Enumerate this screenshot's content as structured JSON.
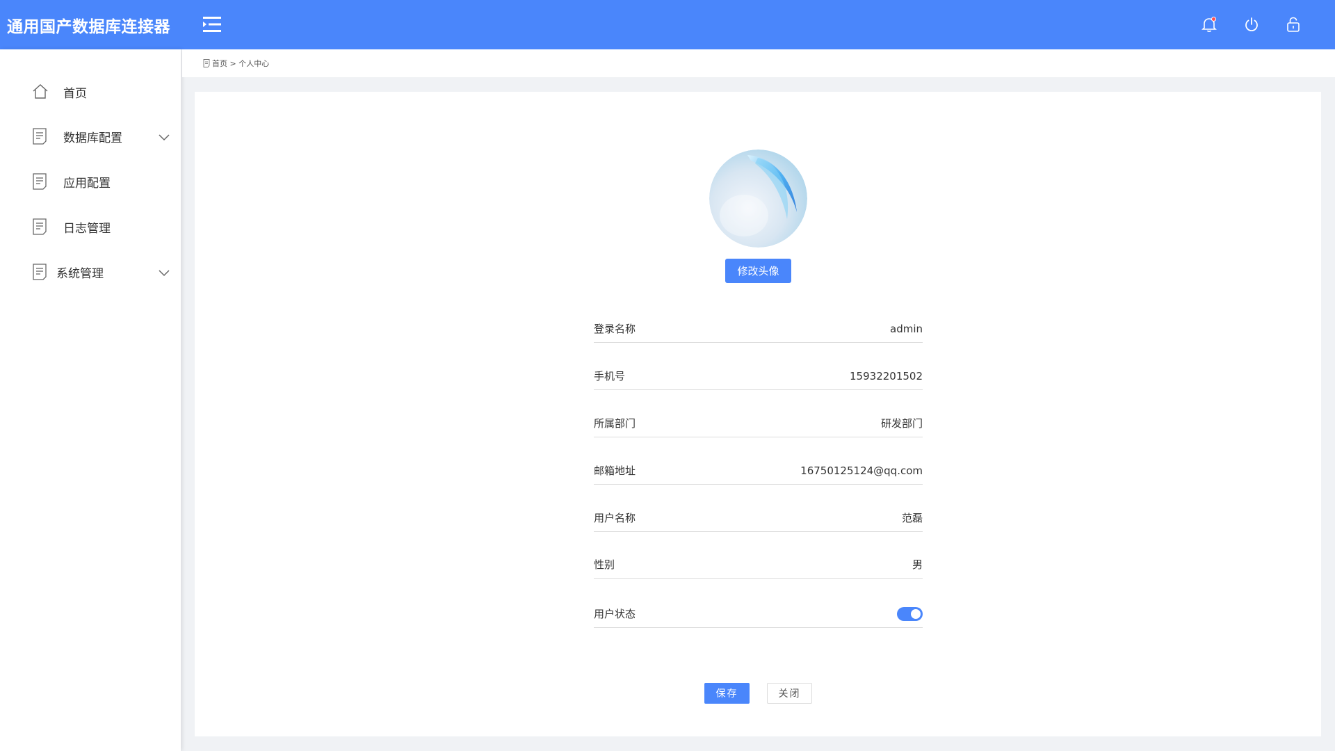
{
  "app": {
    "title": "通用国产数据库连接器"
  },
  "header": {
    "icons": [
      "menu-toggle-icon",
      "bell-icon",
      "power-icon",
      "lock-icon"
    ],
    "accent_color": "#4a86fb"
  },
  "sidebar": {
    "items": [
      {
        "label": "首页",
        "icon": "home-icon",
        "expandable": false
      },
      {
        "label": "数据库配置",
        "icon": "document-icon",
        "expandable": true
      },
      {
        "label": "应用配置",
        "icon": "document-icon",
        "expandable": false
      },
      {
        "label": "日志管理",
        "icon": "document-icon",
        "expandable": false
      },
      {
        "label": "系统管理",
        "icon": "document-icon",
        "expandable": true
      }
    ]
  },
  "breadcrumb": {
    "text": "首页 > 个人中心"
  },
  "profile": {
    "change_avatar_label": "修改头像",
    "fields": [
      {
        "label": "登录名称",
        "value": "admin"
      },
      {
        "label": "手机号",
        "value": "15932201502"
      },
      {
        "label": "所属部门",
        "value": "研发部门"
      },
      {
        "label": "邮箱地址",
        "value": "16750125124@qq.com"
      },
      {
        "label": "用户名称",
        "value": "范磊"
      },
      {
        "label": "性别",
        "value": "男"
      }
    ],
    "status": {
      "label": "用户状态",
      "enabled": true
    }
  },
  "actions": {
    "save_label": "保存",
    "close_label": "关闭"
  }
}
